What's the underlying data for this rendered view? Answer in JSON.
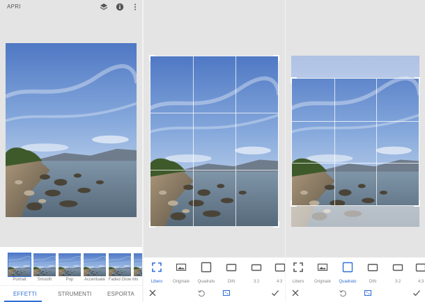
{
  "topbar": {
    "open_label": "APRI"
  },
  "effects": [
    {
      "label": "Portrait"
    },
    {
      "label": "Smooth"
    },
    {
      "label": "Pop"
    },
    {
      "label": "Accentuate"
    },
    {
      "label": "Faded Glow"
    },
    {
      "label": "Mo"
    }
  ],
  "tabs": {
    "effects": "EFFETTI",
    "tools": "STRUMENTI",
    "export": "ESPORTA"
  },
  "ratios_panel2": [
    {
      "label": "Libero"
    },
    {
      "label": "Originale"
    },
    {
      "label": "Quadrato"
    },
    {
      "label": "DIN"
    },
    {
      "label": "3:2"
    },
    {
      "label": "4:3"
    }
  ],
  "ratios_panel3": [
    {
      "label": "Libero"
    },
    {
      "label": "Originale"
    },
    {
      "label": "Quadrato"
    },
    {
      "label": "DIN"
    },
    {
      "label": "3:2"
    },
    {
      "label": "4:3"
    }
  ],
  "icons": {
    "layers": "layers-icon",
    "info": "info-icon",
    "more": "more-vert-icon",
    "close": "close-icon",
    "rotate": "rotate-icon",
    "ratio": "aspect-ratio-icon",
    "confirm": "check-icon"
  },
  "colors": {
    "accent": "#2f6fd6"
  }
}
